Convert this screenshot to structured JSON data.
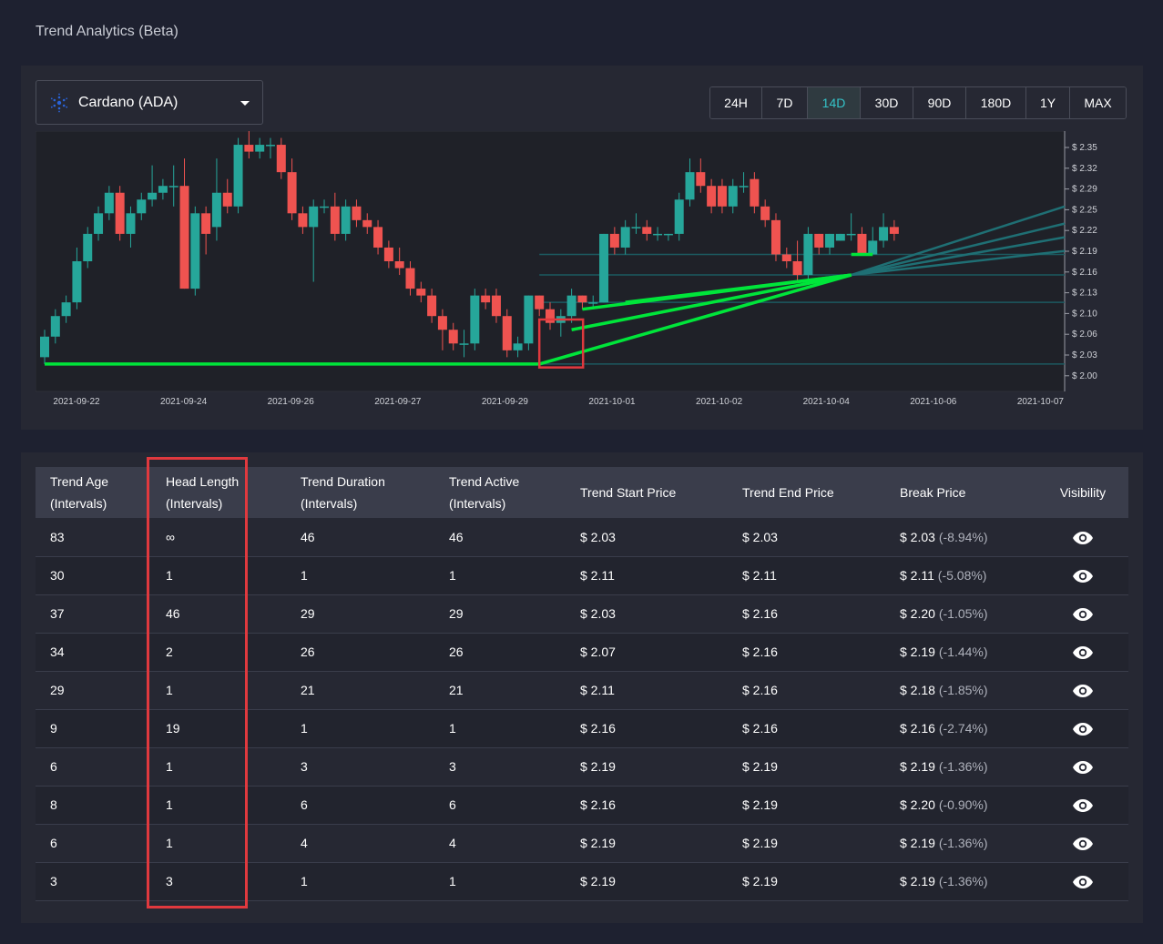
{
  "page": {
    "title": "Trend Analytics (Beta)"
  },
  "coin_selector": {
    "label": "Cardano (ADA)",
    "icon": "cardano-icon"
  },
  "time_ranges": {
    "options": [
      "24H",
      "7D",
      "14D",
      "30D",
      "90D",
      "180D",
      "1Y",
      "MAX"
    ],
    "active": "14D"
  },
  "colors": {
    "background": "#1e2130",
    "panel": "#262833",
    "bull": "#26a69a",
    "bear": "#ef5350",
    "trendline": "#00e53a",
    "accent": "#34c3c8",
    "highlight": "#e0393e"
  },
  "chart_data": {
    "type": "candlestick",
    "x_labels": [
      "2021-09-22",
      "2021-09-24",
      "2021-09-26",
      "2021-09-27",
      "2021-09-29",
      "2021-10-01",
      "2021-10-02",
      "2021-10-04",
      "2021-10-06",
      "2021-10-07"
    ],
    "y_ticks": [
      "$ 2.35",
      "$ 2.32",
      "$ 2.29",
      "$ 2.25",
      "$ 2.22",
      "$ 2.19",
      "$ 2.16",
      "$ 2.13",
      "$ 2.10",
      "$ 2.06",
      "$ 2.03",
      "$ 2.00"
    ],
    "ylim": [
      1.99,
      2.37
    ],
    "candles": [
      [
        2.04,
        2.07,
        2.03,
        2.08
      ],
      [
        2.07,
        2.1,
        2.06,
        2.11
      ],
      [
        2.1,
        2.12,
        2.09,
        2.13
      ],
      [
        2.12,
        2.18,
        2.11,
        2.2
      ],
      [
        2.18,
        2.22,
        2.17,
        2.23
      ],
      [
        2.22,
        2.25,
        2.21,
        2.26
      ],
      [
        2.25,
        2.28,
        2.24,
        2.29
      ],
      [
        2.28,
        2.22,
        2.21,
        2.29
      ],
      [
        2.22,
        2.25,
        2.2,
        2.26
      ],
      [
        2.25,
        2.27,
        2.24,
        2.28
      ],
      [
        2.27,
        2.28,
        2.26,
        2.32
      ],
      [
        2.28,
        2.29,
        2.27,
        2.3
      ],
      [
        2.29,
        2.29,
        2.26,
        2.32
      ],
      [
        2.29,
        2.14,
        2.14,
        2.33
      ],
      [
        2.14,
        2.25,
        2.13,
        2.26
      ],
      [
        2.25,
        2.22,
        2.19,
        2.26
      ],
      [
        2.23,
        2.28,
        2.21,
        2.33
      ],
      [
        2.28,
        2.26,
        2.25,
        2.3
      ],
      [
        2.26,
        2.35,
        2.25,
        2.36
      ],
      [
        2.35,
        2.34,
        2.33,
        2.37
      ],
      [
        2.34,
        2.35,
        2.33,
        2.36
      ],
      [
        2.35,
        2.35,
        2.33,
        2.36
      ],
      [
        2.35,
        2.31,
        2.3,
        2.36
      ],
      [
        2.31,
        2.25,
        2.24,
        2.33
      ],
      [
        2.25,
        2.23,
        2.22,
        2.26
      ],
      [
        2.23,
        2.26,
        2.15,
        2.27
      ],
      [
        2.26,
        2.26,
        2.25,
        2.27
      ],
      [
        2.26,
        2.22,
        2.21,
        2.28
      ],
      [
        2.22,
        2.26,
        2.21,
        2.27
      ],
      [
        2.26,
        2.24,
        2.23,
        2.27
      ],
      [
        2.24,
        2.23,
        2.22,
        2.25
      ],
      [
        2.23,
        2.2,
        2.19,
        2.24
      ],
      [
        2.2,
        2.18,
        2.17,
        2.21
      ],
      [
        2.18,
        2.17,
        2.16,
        2.2
      ],
      [
        2.17,
        2.14,
        2.13,
        2.18
      ],
      [
        2.14,
        2.13,
        2.12,
        2.15
      ],
      [
        2.13,
        2.1,
        2.09,
        2.14
      ],
      [
        2.1,
        2.08,
        2.05,
        2.11
      ],
      [
        2.08,
        2.06,
        2.05,
        2.09
      ],
      [
        2.06,
        2.06,
        2.04,
        2.08
      ],
      [
        2.06,
        2.13,
        2.05,
        2.14
      ],
      [
        2.13,
        2.12,
        2.11,
        2.14
      ],
      [
        2.13,
        2.1,
        2.09,
        2.14
      ],
      [
        2.1,
        2.05,
        2.04,
        2.11
      ],
      [
        2.05,
        2.06,
        2.04,
        2.07
      ],
      [
        2.06,
        2.13,
        2.05,
        2.13
      ],
      [
        2.13,
        2.11,
        2.1,
        2.13
      ],
      [
        2.11,
        2.09,
        2.08,
        2.12
      ],
      [
        2.09,
        2.1,
        2.07,
        2.11
      ],
      [
        2.1,
        2.13,
        2.09,
        2.14
      ],
      [
        2.13,
        2.12,
        2.11,
        2.13
      ],
      [
        2.12,
        2.12,
        2.11,
        2.13
      ],
      [
        2.12,
        2.22,
        2.12,
        2.22
      ],
      [
        2.22,
        2.2,
        2.19,
        2.23
      ],
      [
        2.2,
        2.23,
        2.19,
        2.24
      ],
      [
        2.23,
        2.23,
        2.22,
        2.25
      ],
      [
        2.23,
        2.22,
        2.21,
        2.24
      ],
      [
        2.22,
        2.22,
        2.21,
        2.23
      ],
      [
        2.22,
        2.22,
        2.21,
        2.22
      ],
      [
        2.22,
        2.27,
        2.21,
        2.28
      ],
      [
        2.27,
        2.31,
        2.26,
        2.33
      ],
      [
        2.31,
        2.29,
        2.28,
        2.33
      ],
      [
        2.29,
        2.26,
        2.25,
        2.3
      ],
      [
        2.29,
        2.26,
        2.25,
        2.3
      ],
      [
        2.26,
        2.29,
        2.25,
        2.3
      ],
      [
        2.29,
        2.29,
        2.28,
        2.31
      ],
      [
        2.3,
        2.26,
        2.25,
        2.31
      ],
      [
        2.26,
        2.24,
        2.23,
        2.27
      ],
      [
        2.24,
        2.19,
        2.18,
        2.25
      ],
      [
        2.19,
        2.18,
        2.17,
        2.2
      ],
      [
        2.18,
        2.16,
        2.15,
        2.21
      ],
      [
        2.16,
        2.22,
        2.15,
        2.23
      ],
      [
        2.22,
        2.2,
        2.19,
        2.22
      ],
      [
        2.2,
        2.22,
        2.19,
        2.22
      ],
      [
        2.21,
        2.22,
        2.21,
        2.22
      ],
      [
        2.22,
        2.22,
        2.21,
        2.25
      ],
      [
        2.22,
        2.19,
        2.19,
        2.23
      ],
      [
        2.19,
        2.21,
        2.19,
        2.23
      ],
      [
        2.21,
        2.23,
        2.2,
        2.25
      ],
      [
        2.23,
        2.22,
        2.21,
        2.24
      ]
    ],
    "trendlines": [
      {
        "from": [
          0,
          2.03
        ],
        "to": [
          46,
          2.03
        ]
      },
      {
        "from": [
          46,
          2.03
        ],
        "to": [
          75,
          2.16
        ]
      },
      {
        "from": [
          49,
          2.08
        ],
        "to": [
          75,
          2.16
        ]
      },
      {
        "from": [
          50,
          2.11
        ],
        "to": [
          75,
          2.16
        ]
      },
      {
        "from": [
          54,
          2.12
        ],
        "to": [
          75,
          2.16
        ]
      },
      {
        "from": [
          75,
          2.19
        ],
        "to": [
          77,
          2.19
        ]
      }
    ],
    "projections": [
      {
        "from": [
          75,
          2.16
        ],
        "to": [
          95,
          2.26
        ]
      },
      {
        "from": [
          75,
          2.16
        ],
        "to": [
          95,
          2.235
        ]
      },
      {
        "from": [
          75,
          2.16
        ],
        "to": [
          95,
          2.215
        ]
      },
      {
        "from": [
          75,
          2.16
        ],
        "to": [
          95,
          2.195
        ]
      }
    ],
    "levels": [
      2.03,
      2.12,
      2.16,
      2.19
    ]
  },
  "table": {
    "headers": [
      {
        "line1": "Trend Age",
        "line2": "(Intervals)"
      },
      {
        "line1": "Head Length",
        "line2": "(Intervals)"
      },
      {
        "line1": "Trend Duration",
        "line2": "(Intervals)"
      },
      {
        "line1": "Trend Active",
        "line2": "(Intervals)"
      },
      {
        "line1": "Trend Start Price",
        "line2": ""
      },
      {
        "line1": "Trend End Price",
        "line2": ""
      },
      {
        "line1": "Break Price",
        "line2": ""
      },
      {
        "line1": "Visibility",
        "line2": ""
      }
    ],
    "rows": [
      {
        "age": "83",
        "head": "∞",
        "duration": "46",
        "active": "46",
        "start": "$ 2.03",
        "end": "$ 2.03",
        "break": "$ 2.03",
        "pct": "(-8.94%)"
      },
      {
        "age": "30",
        "head": "1",
        "duration": "1",
        "active": "1",
        "start": "$ 2.11",
        "end": "$ 2.11",
        "break": "$ 2.11",
        "pct": "(-5.08%)"
      },
      {
        "age": "37",
        "head": "46",
        "duration": "29",
        "active": "29",
        "start": "$ 2.03",
        "end": "$ 2.16",
        "break": "$ 2.20",
        "pct": "(-1.05%)"
      },
      {
        "age": "34",
        "head": "2",
        "duration": "26",
        "active": "26",
        "start": "$ 2.07",
        "end": "$ 2.16",
        "break": "$ 2.19",
        "pct": "(-1.44%)"
      },
      {
        "age": "29",
        "head": "1",
        "duration": "21",
        "active": "21",
        "start": "$ 2.11",
        "end": "$ 2.16",
        "break": "$ 2.18",
        "pct": "(-1.85%)"
      },
      {
        "age": "9",
        "head": "19",
        "duration": "1",
        "active": "1",
        "start": "$ 2.16",
        "end": "$ 2.16",
        "break": "$ 2.16",
        "pct": "(-2.74%)"
      },
      {
        "age": "6",
        "head": "1",
        "duration": "3",
        "active": "3",
        "start": "$ 2.19",
        "end": "$ 2.19",
        "break": "$ 2.19",
        "pct": "(-1.36%)"
      },
      {
        "age": "8",
        "head": "1",
        "duration": "6",
        "active": "6",
        "start": "$ 2.16",
        "end": "$ 2.19",
        "break": "$ 2.20",
        "pct": "(-0.90%)"
      },
      {
        "age": "6",
        "head": "1",
        "duration": "4",
        "active": "4",
        "start": "$ 2.19",
        "end": "$ 2.19",
        "break": "$ 2.19",
        "pct": "(-1.36%)"
      },
      {
        "age": "3",
        "head": "3",
        "duration": "1",
        "active": "1",
        "start": "$ 2.19",
        "end": "$ 2.19",
        "break": "$ 2.19",
        "pct": "(-1.36%)"
      }
    ],
    "visibility_icon": "eye-icon"
  }
}
